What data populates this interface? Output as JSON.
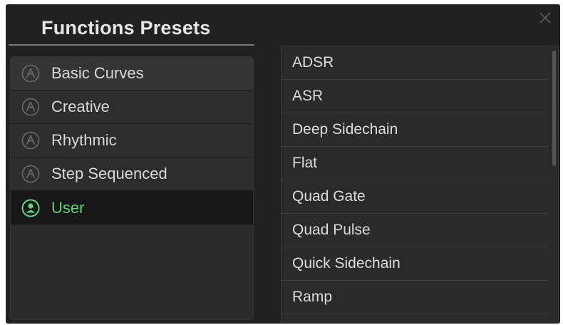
{
  "dialog": {
    "title": "Functions Presets",
    "close_icon": "close-icon"
  },
  "categories": [
    {
      "label": "Basic Curves",
      "icon": "arturia-logo-icon",
      "selected": false
    },
    {
      "label": "Creative",
      "icon": "arturia-logo-icon",
      "selected": false
    },
    {
      "label": "Rhythmic",
      "icon": "arturia-logo-icon",
      "selected": false
    },
    {
      "label": "Step Sequenced",
      "icon": "arturia-logo-icon",
      "selected": false
    },
    {
      "label": "User",
      "icon": "user-icon",
      "selected": true
    }
  ],
  "presets": [
    {
      "label": "ADSR"
    },
    {
      "label": "ASR"
    },
    {
      "label": "Deep Sidechain"
    },
    {
      "label": "Flat"
    },
    {
      "label": "Quad Gate"
    },
    {
      "label": "Quad Pulse"
    },
    {
      "label": "Quick Sidechain"
    },
    {
      "label": "Ramp"
    }
  ],
  "colors": {
    "background": "#212121",
    "selected_accent": "#5fd37a",
    "text": "#d8d8d8"
  }
}
